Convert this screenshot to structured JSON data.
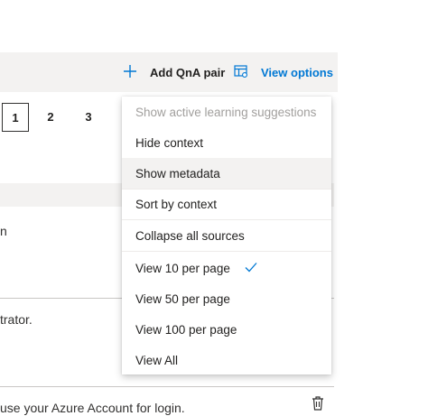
{
  "toolbar": {
    "add_label": "Add QnA pair",
    "add_icon": "plus-icon",
    "view_label": "View options",
    "view_icon": "view-options-icon",
    "accent": "#0078d4"
  },
  "pager": {
    "pages": [
      "1",
      "2",
      "3"
    ],
    "current": "1"
  },
  "background": {
    "partial_1": "n",
    "partial_2": "trator.",
    "partial_3": "use your Azure Account for login.",
    "delete_icon": "trash-icon"
  },
  "menu": {
    "items": [
      {
        "label": "Show active learning suggestions",
        "disabled": true
      },
      {
        "label": "Hide context"
      },
      {
        "label": "Show metadata",
        "hovered": true
      },
      {
        "label": "Sort by context"
      },
      {
        "label": "Collapse all sources"
      },
      {
        "label": "View 10 per page",
        "checked": true
      },
      {
        "label": "View 50 per page"
      },
      {
        "label": "View 100 per page"
      },
      {
        "label": "View All"
      }
    ]
  }
}
